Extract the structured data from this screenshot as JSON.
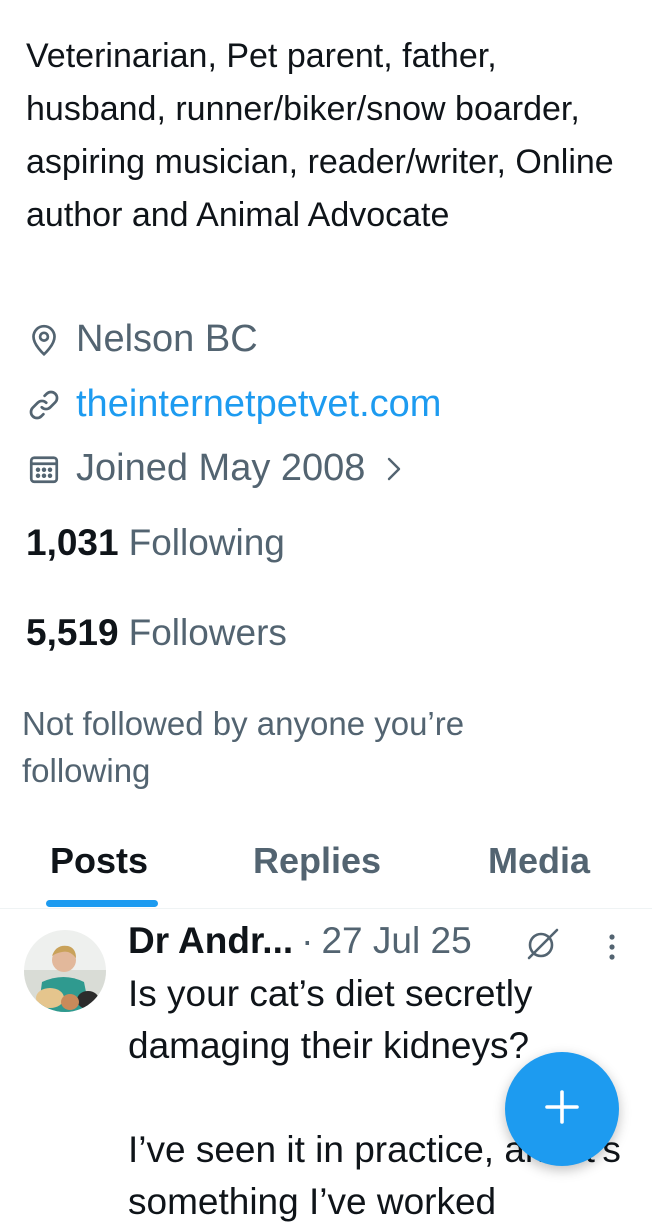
{
  "profile": {
    "bio": "Veterinarian, Pet parent, father, husband, runner/biker/snow boarder, aspiring musician, reader/writer, Online author and Animal Advocate",
    "location": "Nelson BC",
    "website": "theinternetpetvet.com",
    "joined": "Joined May 2008",
    "following_count": "1,031",
    "following_label": "Following",
    "followers_count": "5,519",
    "followers_label": "Followers",
    "not_followed_text": "Not followed by anyone you’re following"
  },
  "tabs": [
    {
      "label": "Posts",
      "active": true
    },
    {
      "label": "Replies",
      "active": false
    },
    {
      "label": "Media",
      "active": false
    }
  ],
  "post": {
    "author": "Dr Andr...",
    "separator": "·",
    "date": "27 Jul 25",
    "text_line1": "Is your cat’s diet secretly damaging their kidneys?",
    "text_line2": "I’ve seen it in practice, and it’s something I’ve worked"
  },
  "icons": {
    "location": "location-pin-icon",
    "website": "link-icon",
    "joined": "calendar-icon",
    "joined_chevron": "chevron-right-icon",
    "grok": "grok-icon",
    "more": "more-vertical-icon",
    "compose": "plus-icon"
  },
  "colors": {
    "accent": "#1d9bf0",
    "text_primary": "#0f1419",
    "text_secondary": "#536471"
  }
}
